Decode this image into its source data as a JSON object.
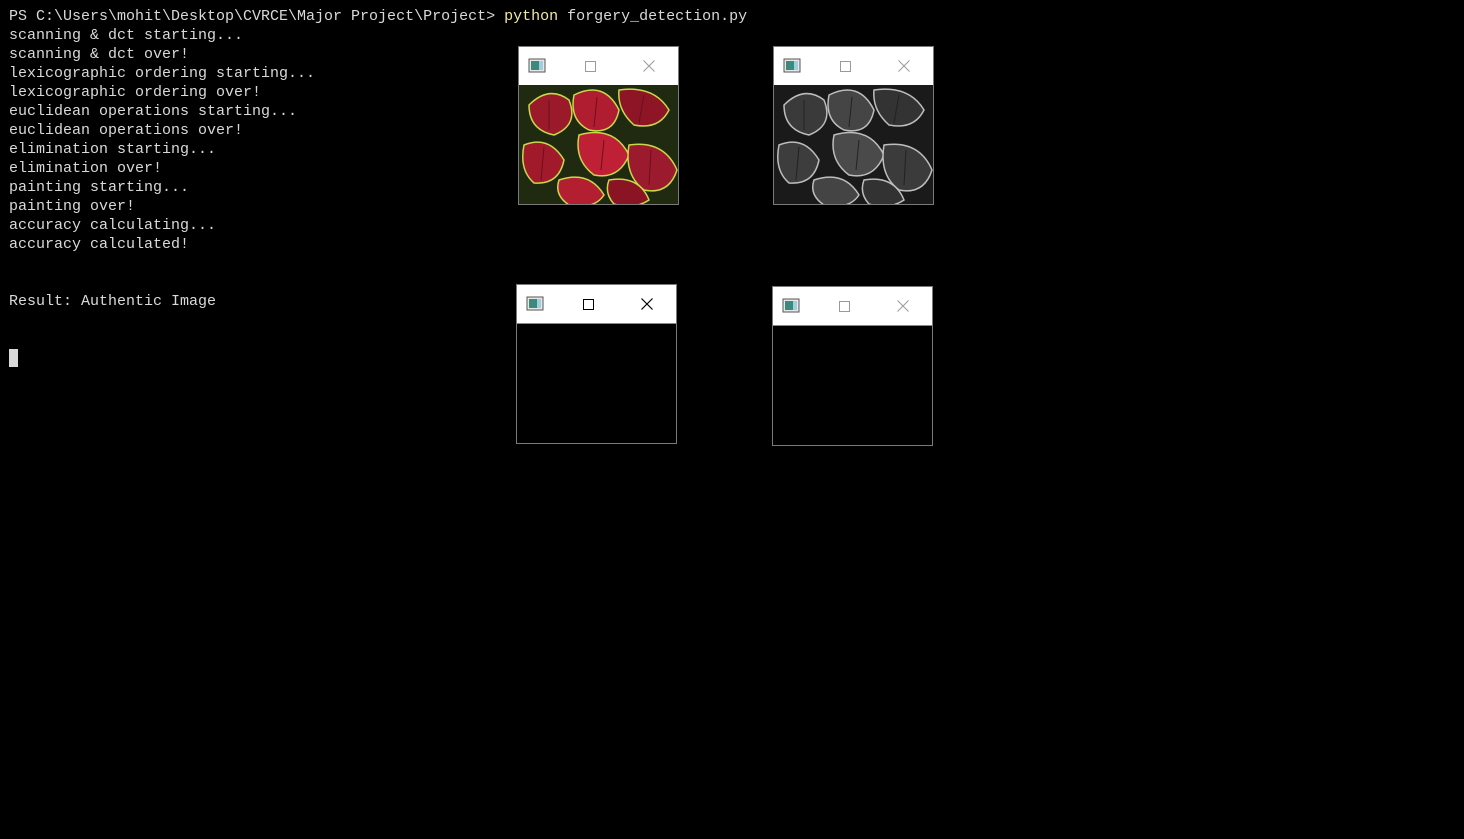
{
  "terminal": {
    "prompt": "PS C:\\Users\\mohit\\Desktop\\CVRCE\\Major Project\\Project> ",
    "command": "python",
    "args": " forgery_detection.py",
    "lines": [
      "scanning & dct starting...",
      "scanning & dct over!",
      "lexicographic ordering starting...",
      "lexicographic ordering over!",
      "euclidean operations starting...",
      "euclidean operations over!",
      "elimination starting...",
      "elimination over!",
      "painting starting...",
      "painting over!",
      "accuracy calculating...",
      "accuracy calculated!"
    ],
    "result": "Result: Authentic Image"
  },
  "windows": [
    {
      "icon": "app-icon",
      "content": "color-leaf-image"
    },
    {
      "icon": "app-icon",
      "content": "grayscale-leaf-image"
    },
    {
      "icon": "app-icon",
      "content": "black-image"
    },
    {
      "icon": "app-icon",
      "content": "black-image"
    }
  ],
  "colors": {
    "background": "#000000",
    "text": "#d9d9d9",
    "command": "#f2e9a0"
  }
}
